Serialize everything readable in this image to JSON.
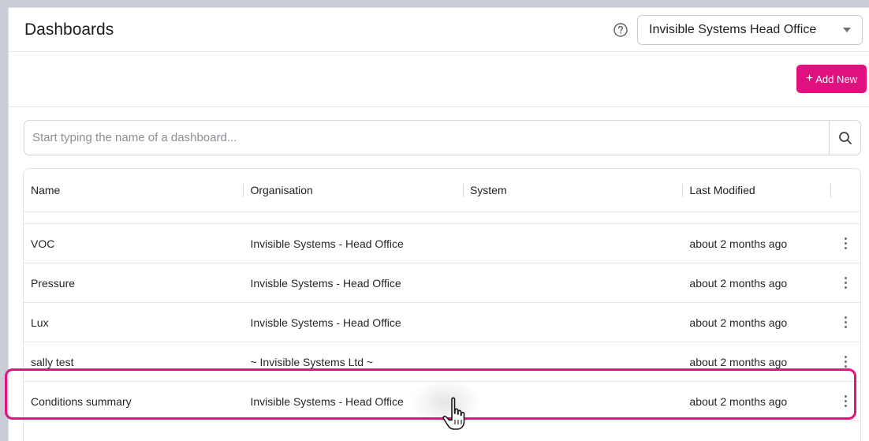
{
  "header": {
    "title": "Dashboards",
    "help_icon": "help-circle-icon",
    "org_select": {
      "value": "Invisible Systems Head Office"
    }
  },
  "toolbar": {
    "add_label": "Add New",
    "add_color": "#e0117f"
  },
  "search": {
    "placeholder": "Start typing the name of a dashboard...",
    "value": ""
  },
  "table": {
    "columns": [
      "Name",
      "Organisation",
      "System",
      "Last Modified"
    ],
    "rows": [
      {
        "name": "VOC",
        "organisation": "Invisible Systems - Head Office",
        "system": "",
        "last_modified": "about 2 months ago"
      },
      {
        "name": "Pressure",
        "organisation": "Invisble Systems - Head Office",
        "system": "",
        "last_modified": "about 2 months ago"
      },
      {
        "name": "Lux",
        "organisation": "Invisble Systems - Head Office",
        "system": "",
        "last_modified": "about 2 months ago"
      },
      {
        "name": "sally test",
        "organisation": "~ Invisible Systems Ltd ~",
        "system": "",
        "last_modified": "about 2 months ago"
      },
      {
        "name": "Conditions summary",
        "organisation": "Invisible Systems - Head Office",
        "system": "",
        "last_modified": "about 2 months ago"
      }
    ]
  },
  "highlight_color": "#e0157f"
}
